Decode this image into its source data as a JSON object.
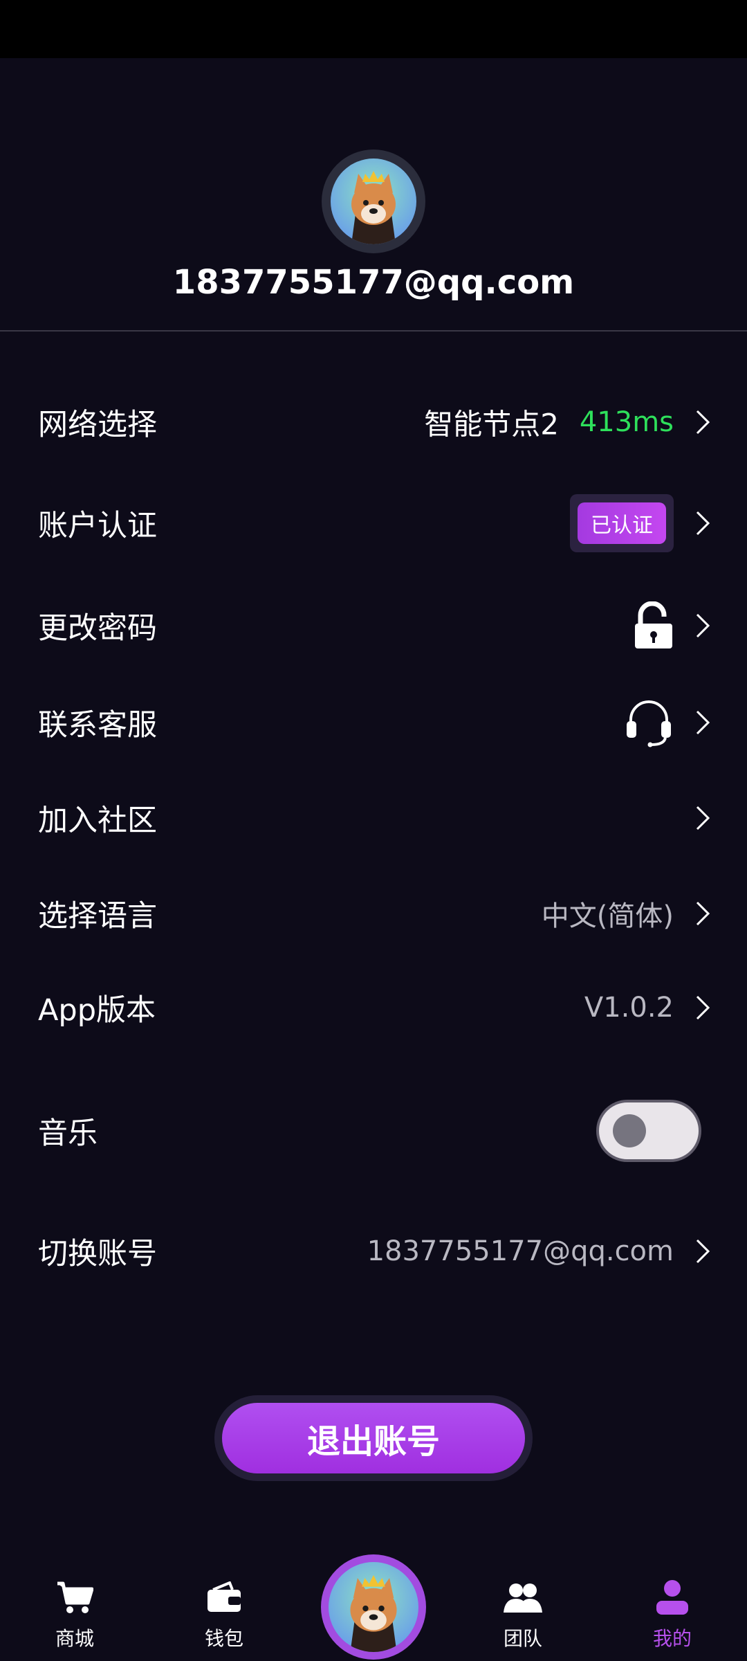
{
  "profile": {
    "email": "1837755177@qq.com"
  },
  "settings": [
    {
      "label": "网络选择",
      "value": "智能节点2",
      "extra": "413ms"
    },
    {
      "label": "账户认证",
      "badge": "已认证"
    },
    {
      "label": "更改密码",
      "icon": "lock-open-icon"
    },
    {
      "label": "联系客服",
      "icon": "headset-icon"
    },
    {
      "label": "加入社区"
    },
    {
      "label": "选择语言",
      "value": "中文(简体)"
    },
    {
      "label": "App版本",
      "value": "V1.0.2"
    },
    {
      "label": "音乐",
      "toggle": false
    },
    {
      "label": "切换账号",
      "value": "1837755177@qq.com"
    }
  ],
  "logout": {
    "label": "退出账号"
  },
  "tabbar": {
    "items": [
      {
        "label": "商城",
        "icon": "cart-icon"
      },
      {
        "label": "钱包",
        "icon": "wallet-icon"
      },
      {
        "label": "",
        "icon": "center-avatar"
      },
      {
        "label": "团队",
        "icon": "team-icon"
      },
      {
        "label": "我的",
        "icon": "user-icon",
        "active": true
      }
    ]
  },
  "colors": {
    "background": "#0d0b19",
    "accent": "#b650ec",
    "ping": "#2ee05b"
  }
}
